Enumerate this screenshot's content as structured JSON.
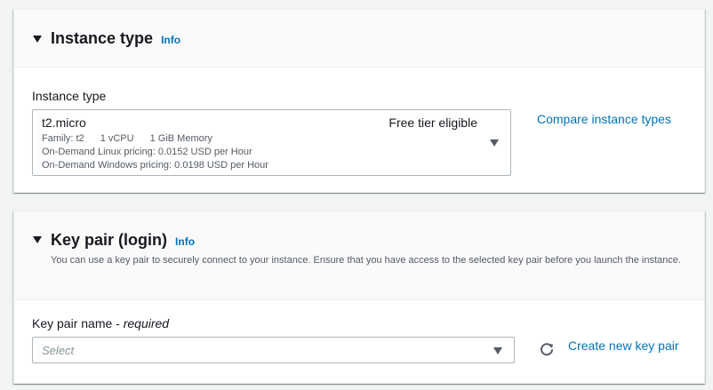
{
  "instance_type_section": {
    "title": "Instance type",
    "info_link": "Info",
    "field_label": "Instance type",
    "selected": {
      "name": "t2.micro",
      "badge": "Free tier eligible",
      "family": "Family: t2",
      "vcpu": "1 vCPU",
      "memory": "1 GiB Memory",
      "linux_pricing": "On-Demand Linux pricing: 0.0152 USD per Hour",
      "windows_pricing": "On-Demand Windows pricing: 0.0198 USD per Hour"
    },
    "compare_link": "Compare instance types"
  },
  "key_pair_section": {
    "title": "Key pair (login)",
    "info_link": "Info",
    "description": "You can use a key pair to securely connect to your instance. Ensure that you have access to the selected key pair before you launch the instance.",
    "field_label": "Key pair name - ",
    "field_required": "required",
    "select_placeholder": "Select",
    "create_link": "Create new key pair"
  },
  "icons": {
    "expand_caret": "caret-down-icon",
    "dropdown": "dropdown-arrow-icon",
    "refresh": "refresh-icon"
  }
}
